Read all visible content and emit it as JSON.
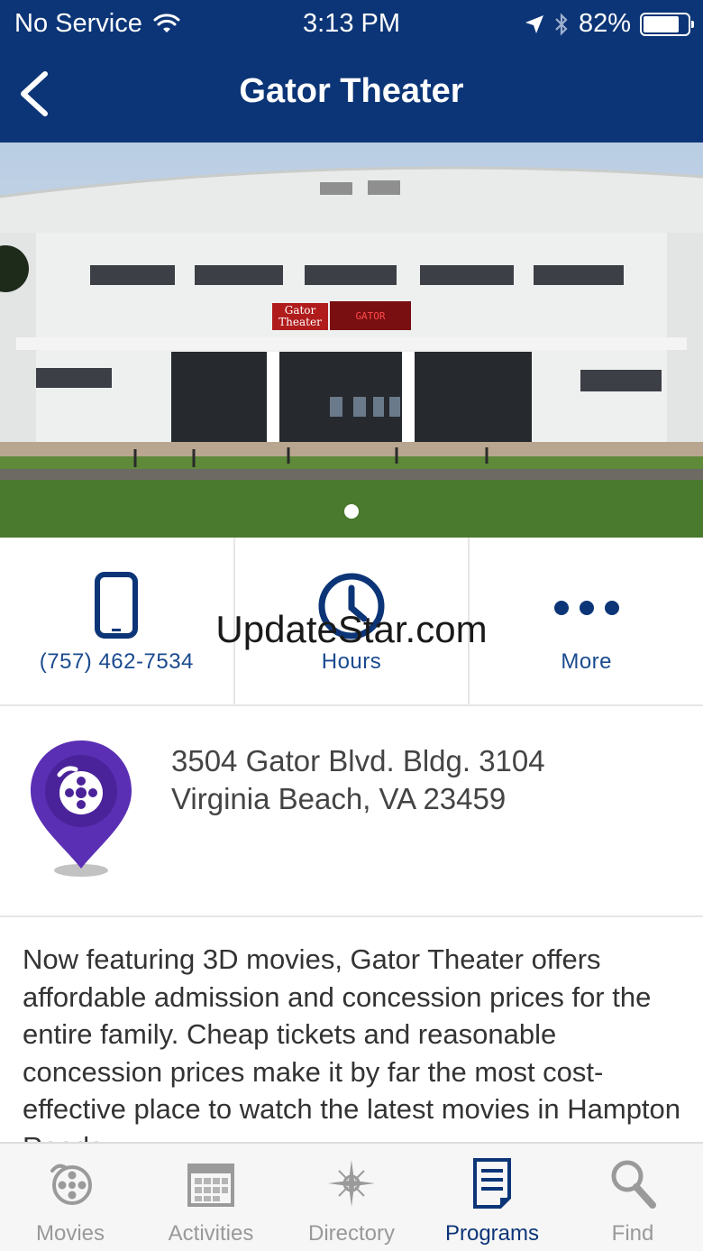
{
  "status_bar": {
    "carrier": "No Service",
    "time": "3:13 PM",
    "battery": "82%",
    "battery_level": 0.82
  },
  "nav": {
    "title": "Gator Theater",
    "back_icon": "chevron-left-icon"
  },
  "hero": {
    "sign_text": "Gator Theater",
    "marquee_text": "GATOR THEATER",
    "page_count": 1,
    "current_page": 1
  },
  "actions": [
    {
      "label": "(757) 462-7534",
      "icon": "phone-icon"
    },
    {
      "label": "Hours",
      "icon": "clock-icon"
    },
    {
      "label": "More",
      "icon": "more-dots-icon"
    }
  ],
  "watermark": "UpdateStar.com",
  "address": {
    "line1": "3504 Gator Blvd.  Bldg. 3104",
    "line2": "Virginia Beach, VA 23459",
    "icon": "movie-pin-icon"
  },
  "description": "Now featuring 3D movies, Gator Theater offers affordable admission and concession prices for the entire family.  Cheap tickets and reasonable concession prices make it by far the most cost-effective place to watch the latest movies in Hampton Roads.",
  "tabs": [
    {
      "label": "Movies",
      "icon": "film-reel-icon",
      "active": false
    },
    {
      "label": "Activities",
      "icon": "calendar-icon",
      "active": false
    },
    {
      "label": "Directory",
      "icon": "compass-icon",
      "active": false
    },
    {
      "label": "Programs",
      "icon": "document-icon",
      "active": true
    },
    {
      "label": "Find",
      "icon": "search-icon",
      "active": false
    }
  ],
  "colors": {
    "header": "#0c3577",
    "accent": "#1a4a8f",
    "pin": "#5b2fb4",
    "tab_inactive": "#999999"
  }
}
